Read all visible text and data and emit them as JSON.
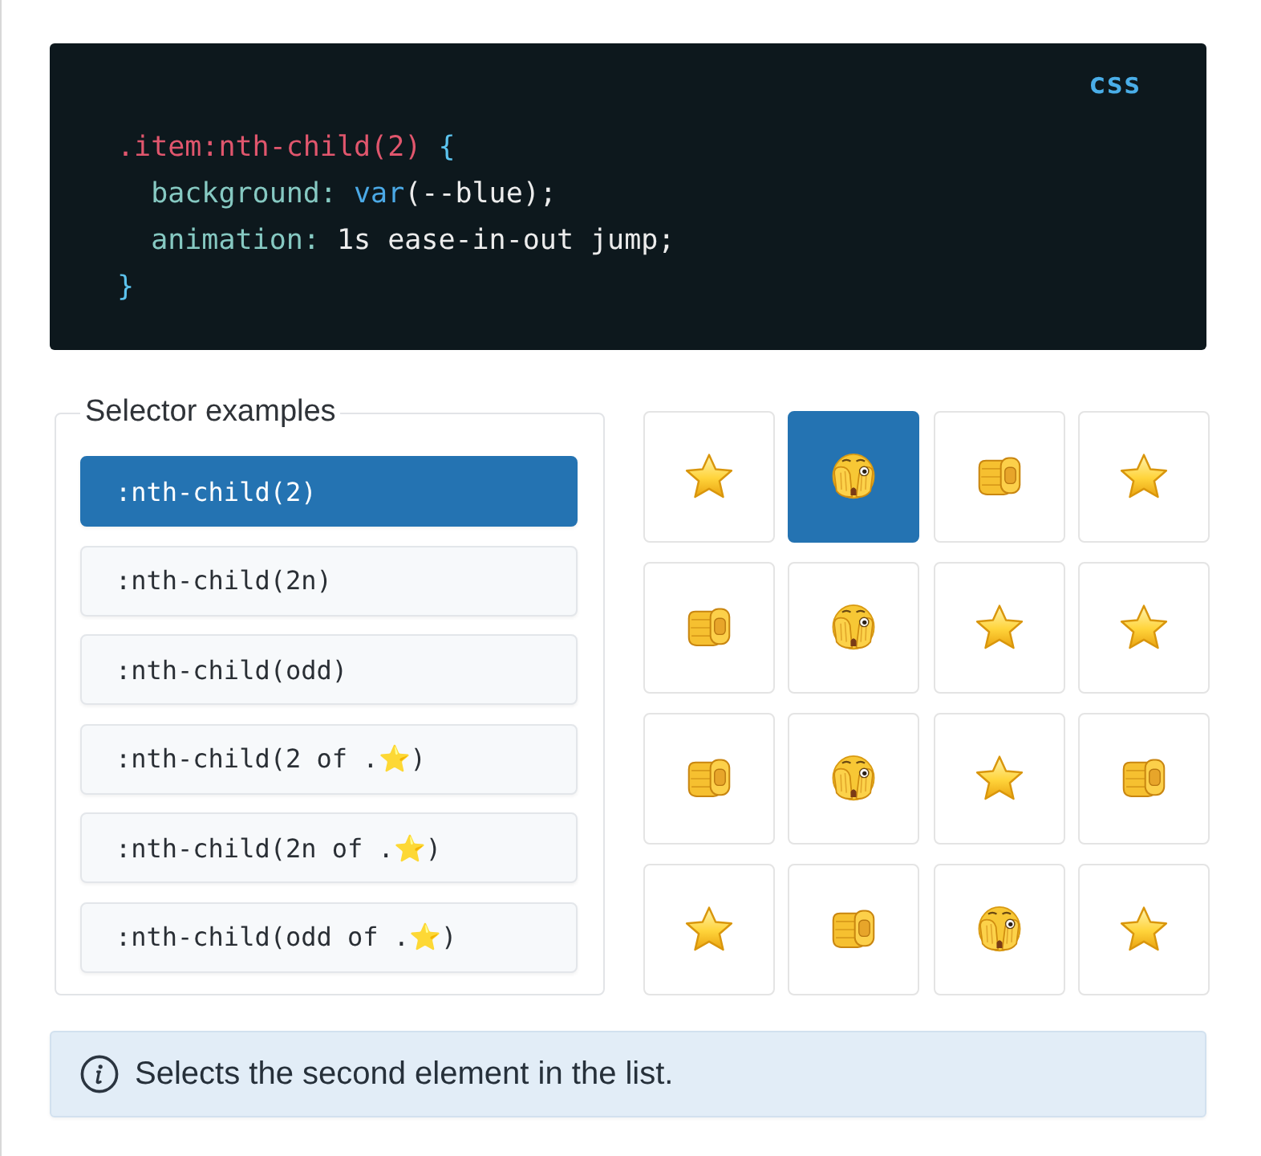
{
  "code": {
    "language": "css",
    "lines": [
      {
        "tokens": [
          {
            "text": ".item:nth-child(2)",
            "kind": "selector"
          },
          {
            "text": " {",
            "kind": "brace"
          }
        ]
      },
      {
        "tokens": [
          {
            "text": "  background:",
            "kind": "property"
          },
          {
            "text": " var",
            "kind": "function"
          },
          {
            "text": "(--blue);",
            "kind": "plain"
          }
        ]
      },
      {
        "tokens": [
          {
            "text": "  animation:",
            "kind": "property"
          },
          {
            "text": " 1s ease-in-out jump;",
            "kind": "plain"
          }
        ]
      },
      {
        "tokens": [
          {
            "text": "}",
            "kind": "brace"
          }
        ]
      }
    ]
  },
  "selector_panel": {
    "legend": "Selector examples",
    "items": [
      {
        "label": ":nth-child(2)",
        "selected": true
      },
      {
        "label": ":nth-child(2n)",
        "selected": false
      },
      {
        "label": ":nth-child(odd)",
        "selected": false
      },
      {
        "label": ":nth-child(2 of .⭐)",
        "selected": false
      },
      {
        "label": ":nth-child(2n of .⭐)",
        "selected": false
      },
      {
        "label": ":nth-child(odd of .⭐)",
        "selected": false
      }
    ]
  },
  "grid": {
    "items": [
      {
        "kind": "star",
        "selected": false
      },
      {
        "kind": "face",
        "selected": true
      },
      {
        "kind": "hand",
        "selected": false
      },
      {
        "kind": "star",
        "selected": false
      },
      {
        "kind": "hand",
        "selected": false
      },
      {
        "kind": "face",
        "selected": false
      },
      {
        "kind": "star",
        "selected": false
      },
      {
        "kind": "star",
        "selected": false
      },
      {
        "kind": "hand",
        "selected": false
      },
      {
        "kind": "face",
        "selected": false
      },
      {
        "kind": "star",
        "selected": false
      },
      {
        "kind": "hand",
        "selected": false
      },
      {
        "kind": "star",
        "selected": false
      },
      {
        "kind": "hand",
        "selected": false
      },
      {
        "kind": "face",
        "selected": false
      },
      {
        "kind": "star",
        "selected": false
      }
    ]
  },
  "description": {
    "text": "Selects the second element in the list."
  }
}
